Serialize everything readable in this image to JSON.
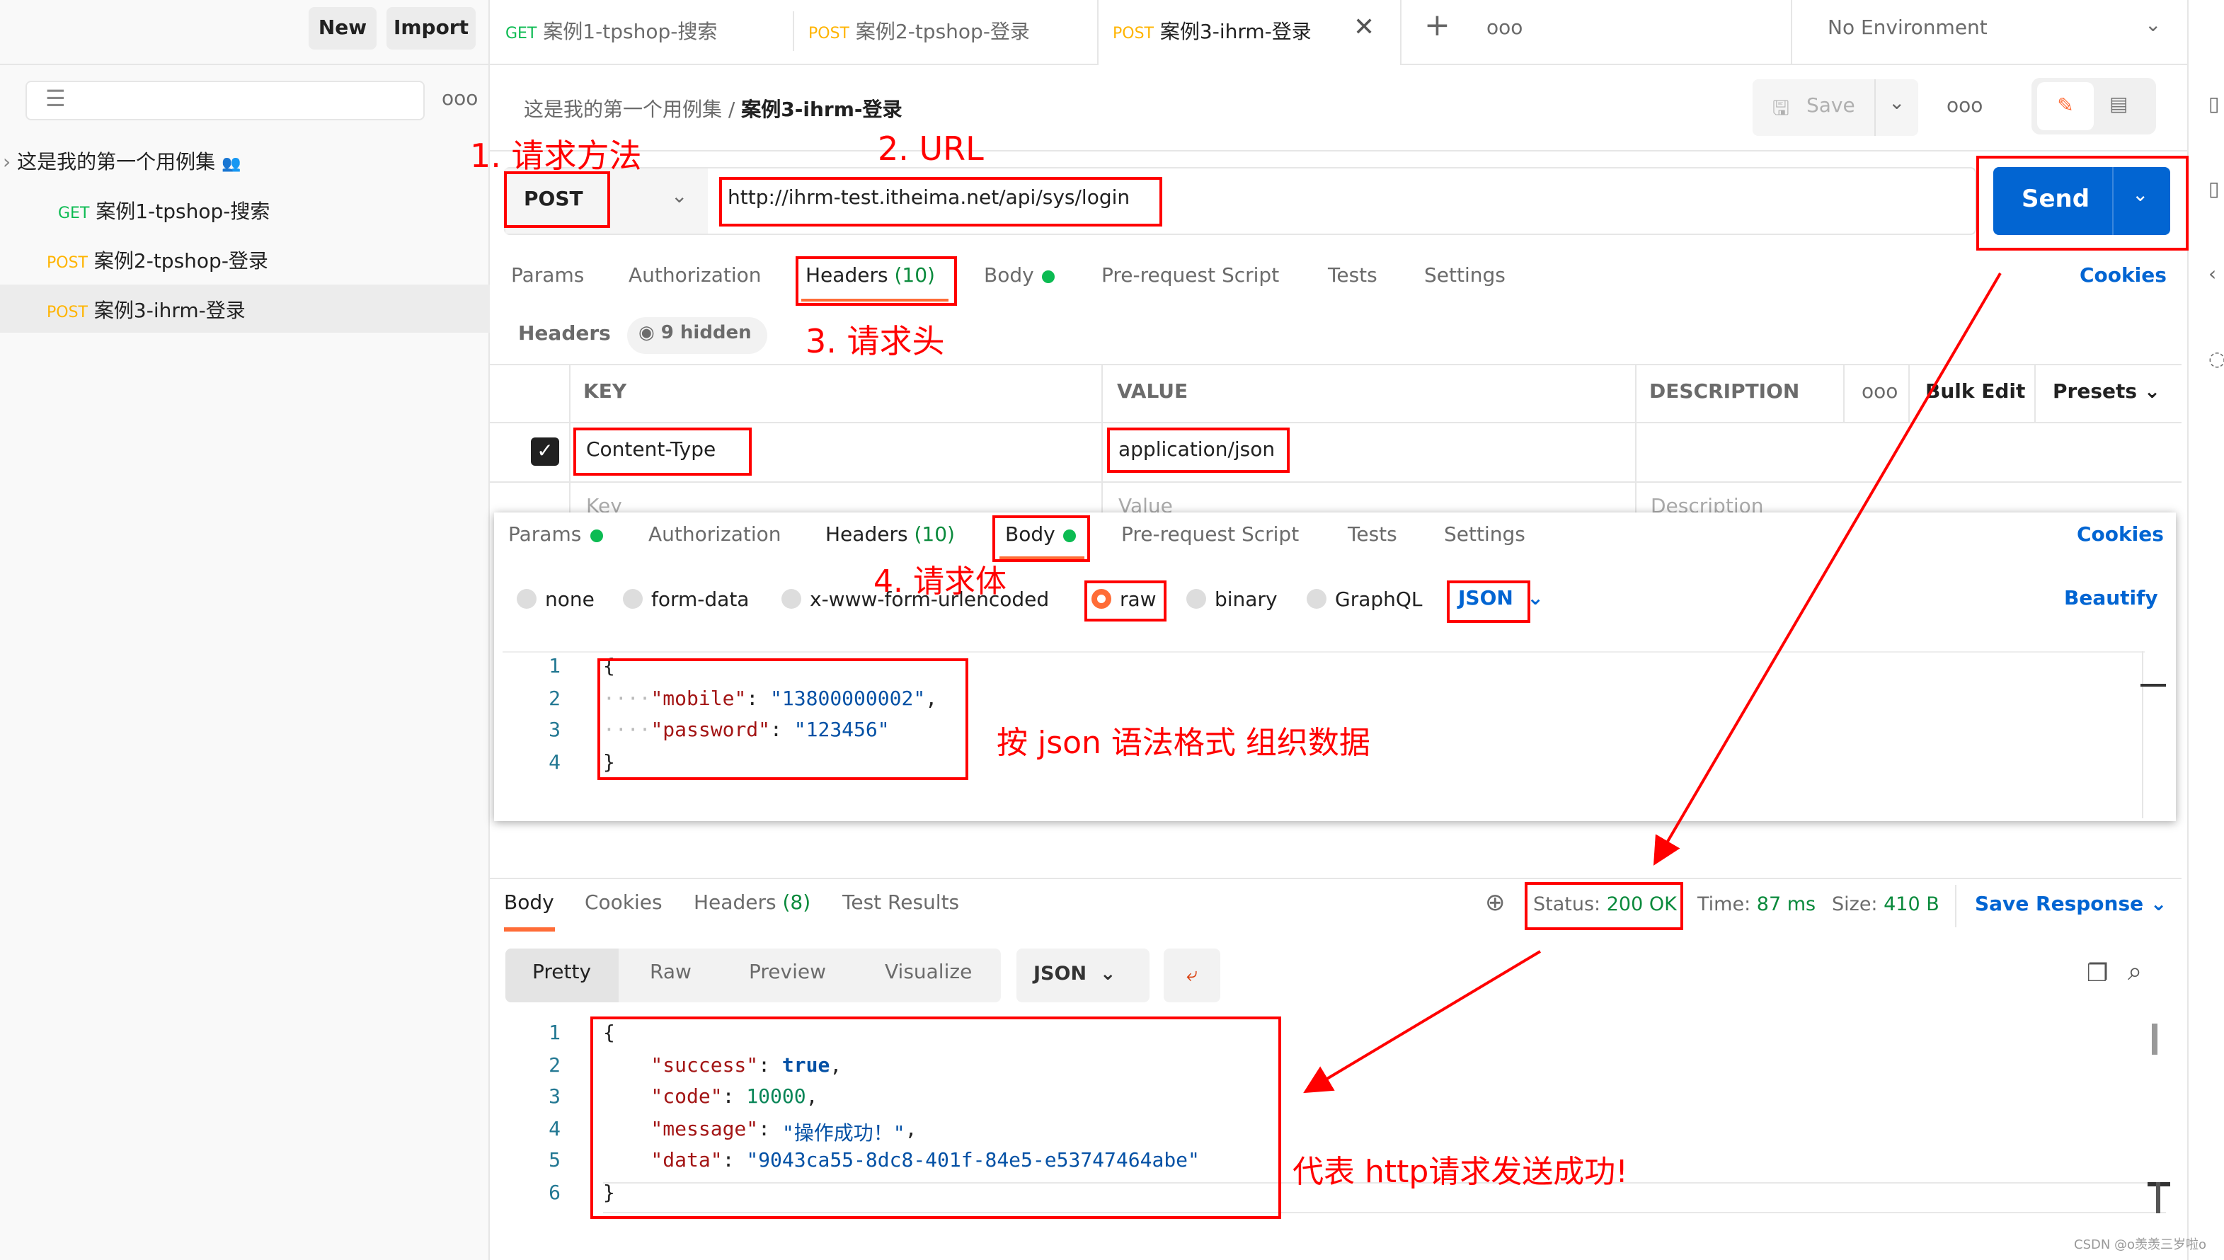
{
  "sidebar": {
    "new_label": "New",
    "import_label": "Import",
    "collection": "这是我的第一个用例集",
    "items": [
      {
        "method": "GET",
        "name": "案例1-tpshop-搜索"
      },
      {
        "method": "POST",
        "name": "案例2-tpshop-登录"
      },
      {
        "method": "POST",
        "name": "案例3-ihrm-登录"
      }
    ]
  },
  "tabs": [
    {
      "method": "GET",
      "name": "案例1-tpshop-搜索"
    },
    {
      "method": "POST",
      "name": "案例2-tpshop-登录"
    },
    {
      "method": "POST",
      "name": "案例3-ihrm-登录"
    }
  ],
  "environment": "No Environment",
  "breadcrumb": {
    "parent": "这是我的第一个用例集",
    "sep": "/",
    "current": "案例3-ihrm-登录"
  },
  "save_label": "Save",
  "request": {
    "method": "POST",
    "url": "http://ihrm-test.itheima.net/api/sys/login",
    "send_label": "Send"
  },
  "req_tabs": {
    "params": "Params",
    "authorization": "Authorization",
    "headers": "Headers",
    "headers_count": "(10)",
    "body": "Body",
    "prerequest": "Pre-request Script",
    "tests": "Tests",
    "settings": "Settings",
    "cookies": "Cookies"
  },
  "headers_section": {
    "title": "Headers",
    "hidden": "9 hidden",
    "columns": {
      "key": "KEY",
      "value": "VALUE",
      "description": "DESCRIPTION",
      "bulk_edit": "Bulk Edit",
      "presets": "Presets"
    },
    "rows": [
      {
        "checked": true,
        "key": "Content-Type",
        "value": "application/json"
      }
    ],
    "placeholders": {
      "key": "Key",
      "value": "Value",
      "description": "Description"
    }
  },
  "body_options": {
    "none": "none",
    "form_data": "form-data",
    "urlencoded": "x-www-form-urlencoded",
    "raw": "raw",
    "binary": "binary",
    "graphql": "GraphQL",
    "format": "JSON",
    "beautify": "Beautify",
    "selected": "raw"
  },
  "request_body": [
    [
      {
        "t": "{",
        "c": "p"
      }
    ],
    [
      {
        "t": "····",
        "c": "ws"
      },
      {
        "t": "\"mobile\"",
        "c": "k"
      },
      {
        "t": ": ",
        "c": "p"
      },
      {
        "t": "\"13800000002\"",
        "c": "s"
      },
      {
        "t": ",",
        "c": "p"
      }
    ],
    [
      {
        "t": "····",
        "c": "ws"
      },
      {
        "t": "\"password\"",
        "c": "k"
      },
      {
        "t": ": ",
        "c": "p"
      },
      {
        "t": "\"123456\"",
        "c": "s"
      }
    ],
    [
      {
        "t": "}",
        "c": "p"
      }
    ]
  ],
  "annotations": {
    "method": "1. 请求方法",
    "url": "2. URL",
    "headers": "3. 请求头",
    "body": "4. 请求体",
    "json_note": "按 json 语法格式 组织数据",
    "success_note": "代表 http请求发送成功!"
  },
  "response": {
    "tabs": {
      "body": "Body",
      "cookies": "Cookies",
      "headers": "Headers",
      "headers_count": "(8)",
      "tests": "Test Results"
    },
    "status_label": "Status:",
    "status": "200 OK",
    "time_label": "Time:",
    "time": "87 ms",
    "size_label": "Size:",
    "size": "410 B",
    "save_response": "Save Response",
    "views": [
      "Pretty",
      "Raw",
      "Preview",
      "Visualize"
    ],
    "active_view": "Pretty",
    "format": "JSON",
    "lines": [
      [
        {
          "t": "{",
          "c": "p"
        }
      ],
      [
        {
          "t": "    \"success\"",
          "c": "k"
        },
        {
          "t": ": ",
          "c": "p"
        },
        {
          "t": "true",
          "c": "b"
        },
        {
          "t": ",",
          "c": "p"
        }
      ],
      [
        {
          "t": "    \"code\"",
          "c": "k"
        },
        {
          "t": ": ",
          "c": "p"
        },
        {
          "t": "10000",
          "c": "n"
        },
        {
          "t": ",",
          "c": "p"
        }
      ],
      [
        {
          "t": "    \"message\"",
          "c": "k"
        },
        {
          "t": ": ",
          "c": "p"
        },
        {
          "t": "\"操作成功！\"",
          "c": "s"
        },
        {
          "t": ",",
          "c": "p"
        }
      ],
      [
        {
          "t": "    \"data\"",
          "c": "k"
        },
        {
          "t": ": ",
          "c": "p"
        },
        {
          "t": "\"9043ca55-8dc8-401f-84e5-e53747464abe\"",
          "c": "s"
        }
      ],
      [
        {
          "t": "}",
          "c": "p"
        }
      ]
    ]
  },
  "watermark": "CSDN @o羡羡三岁啦o",
  "colors": {
    "accent": "#ff6c37",
    "send": "#0265d2",
    "annotation": "#ff0000",
    "status_ok": "#0a8a3c"
  }
}
